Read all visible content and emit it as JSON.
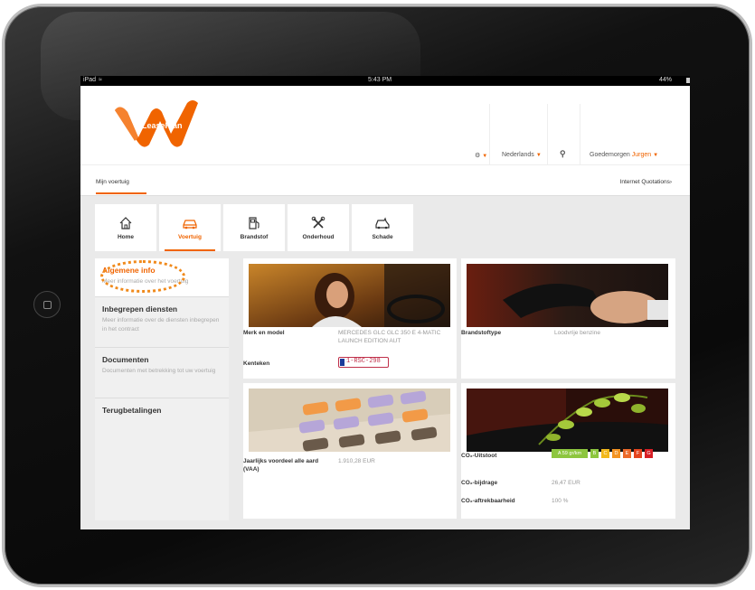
{
  "status_bar": {
    "device": "iPad",
    "time": "5:43 PM",
    "battery": "44%"
  },
  "header": {
    "logo_text": "LeasePlan",
    "settings_icon": "gear-icon",
    "language": "Nederlands",
    "search_icon": "search-icon",
    "greeting": "Goedemorgen",
    "user_name": "Jurgen"
  },
  "subnav": {
    "active_tab": "Mijn voertuig",
    "right_link": "Internet Quotations"
  },
  "tiles": [
    {
      "label": "Home",
      "icon": "home-icon"
    },
    {
      "label": "Voertuig",
      "icon": "car-icon"
    },
    {
      "label": "Brandstof",
      "icon": "fuel-pump-icon"
    },
    {
      "label": "Onderhoud",
      "icon": "tools-icon"
    },
    {
      "label": "Schade",
      "icon": "damaged-car-icon"
    }
  ],
  "sidebar": [
    {
      "title": "Algemene info",
      "desc": "Meer informatie over het voertuig"
    },
    {
      "title": "Inbegrepen diensten",
      "desc": "Meer informatie over de diensten inbegrepen in het contract"
    },
    {
      "title": "Documenten",
      "desc": "Documenten met betrekking tot uw voertuig"
    },
    {
      "title": "Terugbetalingen",
      "desc": ""
    }
  ],
  "vehicle_card": {
    "merk_label": "Merk en model",
    "merk_value": "MERCEDES GLC GLC 350 E 4-MATIC LAUNCH EDITION AUT",
    "kenteken_label": "Kenteken",
    "plate": "1-RSC-298"
  },
  "fuel_card": {
    "label": "Brandstoftype",
    "value": "Loodvrije benzine"
  },
  "vaa_card": {
    "label": "Jaarlijks voordeel alle aard (VAA)",
    "value": "1.910,28 EUR"
  },
  "co2_card": {
    "uitstoot_label": "CO₂-Uitstoot",
    "uitstoot_value": "A 59 gr/km",
    "labels": [
      "B",
      "C",
      "D",
      "E",
      "F",
      "G"
    ],
    "label_colors": [
      "#8dc63f",
      "#f2b81c",
      "#f39322",
      "#ec6a2a",
      "#e4451f",
      "#d71f26"
    ],
    "bijdrage_label": "CO₂-bijdrage",
    "bijdrage_value": "26,47 EUR",
    "aftrek_label": "CO₂-aftrekbaarheid",
    "aftrek_value": "100 %"
  },
  "colors": {
    "accent": "#f06400"
  }
}
